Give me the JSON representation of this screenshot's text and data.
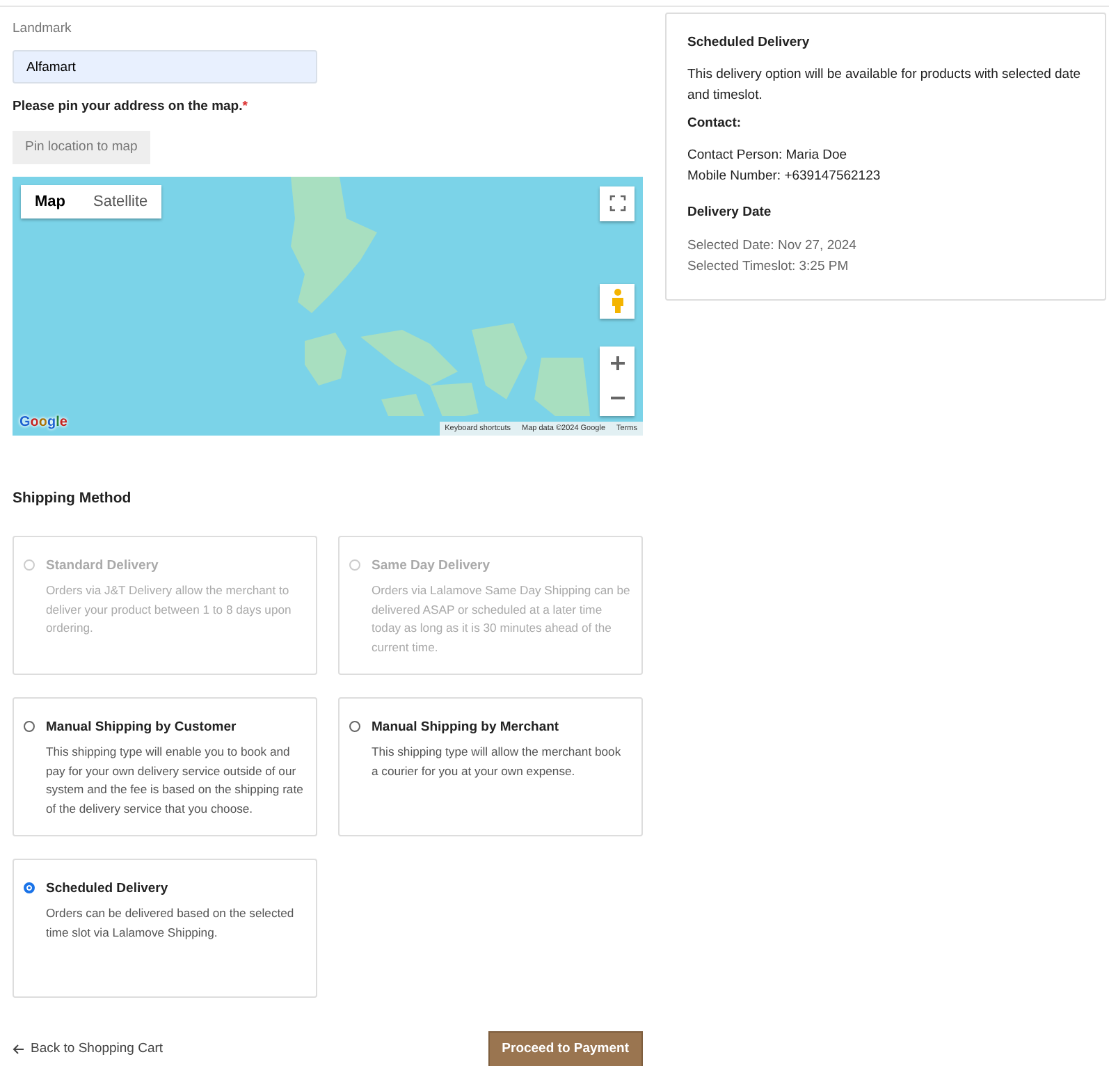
{
  "landmark": {
    "label": "Landmark",
    "value": "Alfamart"
  },
  "pin": {
    "prompt": "Please pin your address on the map.",
    "required_mark": "*",
    "button": "Pin location to map"
  },
  "map": {
    "map_types": [
      {
        "label": "Map",
        "selected": true
      },
      {
        "label": "Satellite",
        "selected": false
      }
    ],
    "logo": "Google",
    "footer": [
      "Keyboard shortcuts",
      "Map data ©2024 Google",
      "Terms"
    ]
  },
  "shipping": {
    "title": "Shipping Method",
    "options": [
      {
        "title": "Standard Delivery",
        "description": "Orders via J&T Delivery allow the merchant to deliver your product between 1 to 8 days upon ordering.",
        "disabled": true,
        "selected": false
      },
      {
        "title": "Same Day Delivery",
        "description": "Orders via Lalamove Same Day Shipping can be delivered ASAP or scheduled at a later time today as long as it is 30 minutes ahead of the current time.",
        "disabled": true,
        "selected": false
      },
      {
        "title": "Manual Shipping by Customer",
        "description": "This shipping type will enable you to book and pay for your own delivery service outside of our system and the fee is based on the shipping rate of the delivery service that you choose.",
        "disabled": false,
        "selected": false
      },
      {
        "title": "Manual Shipping by Merchant",
        "description": "This shipping type will allow the merchant book a courier for you at your own expense.",
        "disabled": false,
        "selected": false
      },
      {
        "title": "Scheduled Delivery",
        "description": "Orders can be delivered based on the selected time slot via Lalamove Shipping.",
        "disabled": false,
        "selected": true
      }
    ]
  },
  "footer": {
    "back_link": "Back to Shopping Cart",
    "proceed_button": "Proceed to Payment"
  },
  "summary": {
    "title": "Scheduled Delivery",
    "description": "This delivery option will be available for products with selected date and timeslot.",
    "contact_title": "Contact:",
    "contact_lines": [
      "Contact Person: Maria Doe",
      "Mobile Number: +639147562123"
    ],
    "date_title": "Delivery Date",
    "date_lines": [
      "Selected Date: Nov 27, 2024",
      "Selected Timeslot: 3:25 PM"
    ]
  }
}
